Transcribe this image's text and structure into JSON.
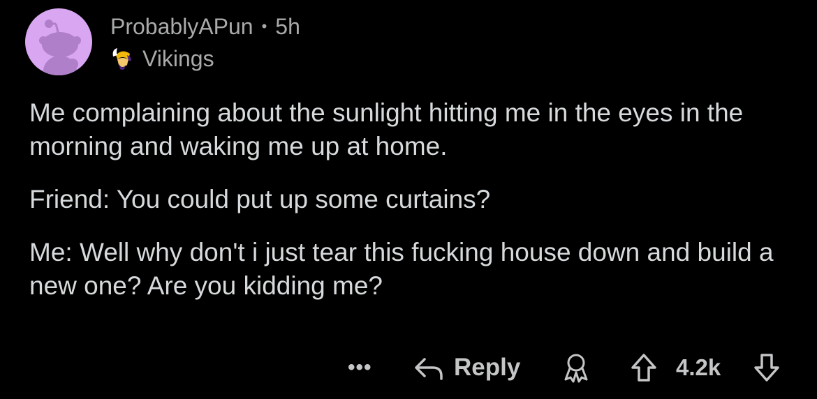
{
  "comment": {
    "author": "ProbablyAPun",
    "separator": "•",
    "age": "5h",
    "flair": {
      "text": "Vikings",
      "icon": "vikings-logo-icon"
    },
    "avatar": {
      "icon": "snoo-avatar-icon",
      "background": "#d9a6f2"
    },
    "paragraphs": [
      "Me complaining about the sunlight hitting me in the eyes in the morning and waking me up at home.",
      "Friend: You could put up some curtains?",
      "Me: Well why don't i just tear this fucking house down and build a new one? Are you kidding me?"
    ]
  },
  "actions": {
    "more_label": "•••",
    "reply_label": "Reply",
    "reply_icon": "reply-arrow-icon",
    "award_icon": "award-icon",
    "upvote_icon": "upvote-arrow-icon",
    "vote_count": "4.2k",
    "downvote_icon": "downvote-arrow-icon"
  },
  "colors": {
    "background": "#000000",
    "text": "#d7dadc",
    "muted": "#a8aaab",
    "avatar": "#d9a6f2"
  }
}
